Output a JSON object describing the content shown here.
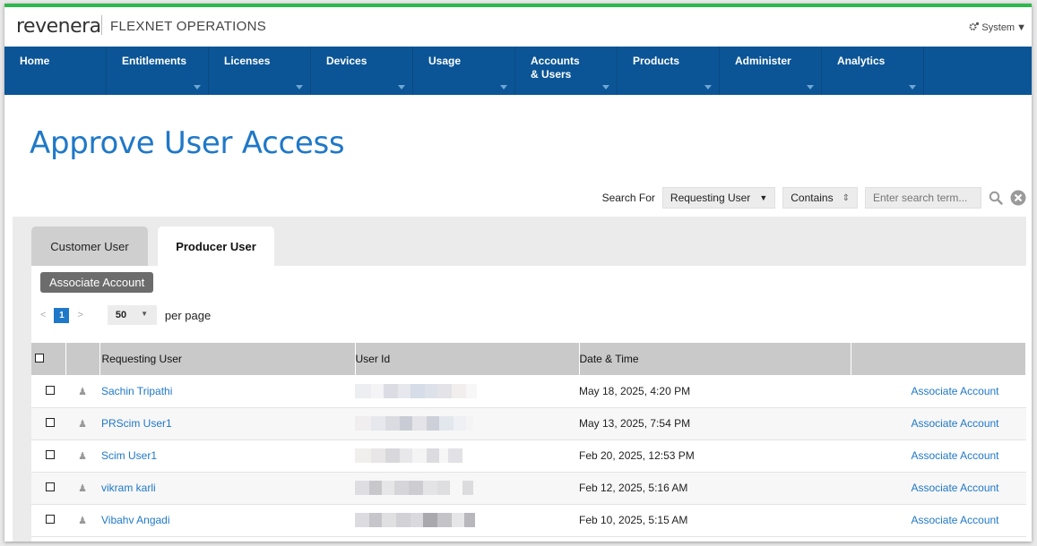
{
  "header": {
    "brand": "revenera",
    "product": "FLEXNET OPERATIONS",
    "system_menu": "System"
  },
  "nav": {
    "items": [
      {
        "label": "Home",
        "caret": false
      },
      {
        "label": "Entitlements",
        "caret": true
      },
      {
        "label": "Licenses",
        "caret": true
      },
      {
        "label": "Devices",
        "caret": true
      },
      {
        "label": "Usage",
        "caret": true
      },
      {
        "label": "Accounts & Users",
        "caret": true
      },
      {
        "label": "Products",
        "caret": true
      },
      {
        "label": "Administer",
        "caret": true
      },
      {
        "label": "Analytics",
        "caret": true
      }
    ]
  },
  "page": {
    "title": "Approve User Access"
  },
  "search": {
    "label": "Search For",
    "field_value": "Requesting User",
    "operator_value": "Contains",
    "placeholder": "Enter search term..."
  },
  "tabs": [
    {
      "label": "Customer User",
      "active": false
    },
    {
      "label": "Producer User",
      "active": true
    }
  ],
  "toolbar": {
    "associate_button": "Associate Account"
  },
  "pager": {
    "prev": "<",
    "current_page": "1",
    "next": ">",
    "per_page_value": "50",
    "per_page_label": "per page"
  },
  "table": {
    "columns": [
      "",
      "",
      "Requesting User",
      "User Id",
      "Date & Time",
      ""
    ],
    "rows": [
      {
        "user": "Sachin Tripathi",
        "date": "May 18, 2025, 4:20 PM",
        "action": "Associate Account"
      },
      {
        "user": "PRScim User1",
        "date": "May 13, 2025, 7:54 PM",
        "action": "Associate Account"
      },
      {
        "user": "Scim User1",
        "date": "Feb 20, 2025, 12:53 PM",
        "action": "Associate Account"
      },
      {
        "user": "vikram karli",
        "date": "Feb 12, 2025, 5:16 AM",
        "action": "Associate Account"
      },
      {
        "user": "Vibahv Angadi",
        "date": "Feb 10, 2025, 5:15 AM",
        "action": "Associate Account"
      }
    ]
  },
  "colors": {
    "accent_green": "#2db84d",
    "nav_blue": "#0b5596",
    "link_blue": "#1f78c8"
  }
}
